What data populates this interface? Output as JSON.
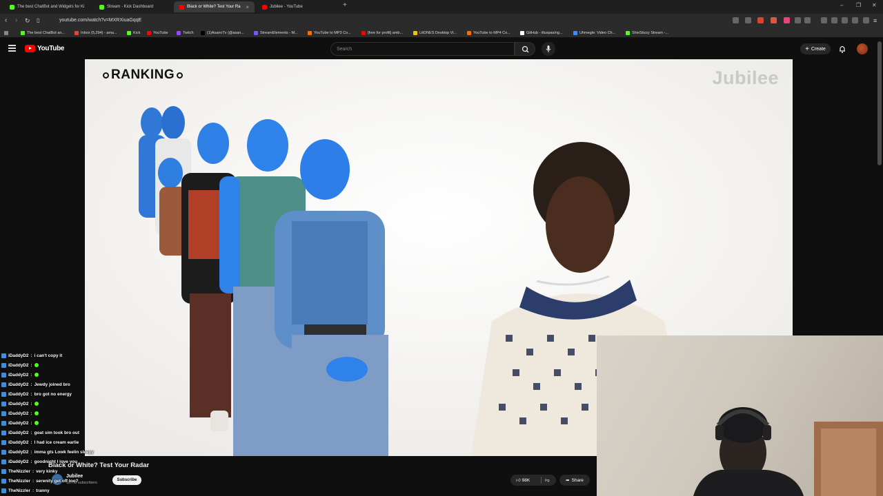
{
  "browser": {
    "tabs": [
      {
        "title": "The best ChatBot and Widgets for Ki",
        "color": "#53fc18"
      },
      {
        "title": "Stream - Kick Dashboard",
        "color": "#53fc18"
      },
      {
        "title": "Black or White? Test Your Ra",
        "color": "#ff0000",
        "active": true
      },
      {
        "title": "Jubilee - YouTube",
        "color": "#ff0000"
      }
    ],
    "url": "youtube.com/watch?v=MXRXiuaGqqE",
    "bookmarks": [
      {
        "label": "The best ChatBot an...",
        "color": "#53fc18"
      },
      {
        "label": "Inbox (5,294) - ama...",
        "color": "#ea4335"
      },
      {
        "label": "Kick",
        "color": "#53fc18"
      },
      {
        "label": "YouTube",
        "color": "#ff0000"
      },
      {
        "label": "Twitch",
        "color": "#9146ff"
      },
      {
        "label": "(1)AsanoTv (@asan...",
        "color": "#000000"
      },
      {
        "label": "StreamElements - M...",
        "color": "#6b5bff"
      },
      {
        "label": "YouTube to MP3 Co...",
        "color": "#ff6b00"
      },
      {
        "label": "[free for profit] amb...",
        "color": "#ff0000"
      },
      {
        "label": "LitONES Desktop Vi...",
        "color": "#f5c400"
      },
      {
        "label": "YouTube to MP4 Co...",
        "color": "#ff6b00"
      },
      {
        "label": "GitHub - illuspas/ng...",
        "color": "#ffffff"
      },
      {
        "label": "Uhmegle: Video Ch...",
        "color": "#3a8bff"
      },
      {
        "label": "ShieStizzy Stream -...",
        "color": "#53fc18"
      }
    ]
  },
  "youtube": {
    "logo_text": "YouTube",
    "search_placeholder": "Search",
    "create_label": "Create"
  },
  "video": {
    "ranking_text": "RANKING",
    "jubilee_watermark": "Jubilee",
    "title": "Black or White? Test Your Radar",
    "channel": "Jubilee",
    "subscribers": "10.7M subscribers",
    "subscribe_label": "Subscribe",
    "likes": "98K",
    "share_label": "Share"
  },
  "chat": [
    {
      "user": "iDaddyD2",
      "text": "i can't copy it"
    },
    {
      "user": "iDaddyD2",
      "text": "",
      "emote": true
    },
    {
      "user": "iDaddyD2",
      "text": "",
      "emote": true
    },
    {
      "user": "iDaddyD2",
      "text": "Jewdy joined bro"
    },
    {
      "user": "iDaddyD2",
      "text": "bro got no energy"
    },
    {
      "user": "iDaddyD2",
      "text": "",
      "emote": true
    },
    {
      "user": "iDaddyD2",
      "text": "",
      "emote": true
    },
    {
      "user": "iDaddyD2",
      "text": "",
      "emote": true
    },
    {
      "user": "iDaddyD2",
      "text": "goat sim took bro out"
    },
    {
      "user": "iDaddyD2",
      "text": "I had ice cream earlie"
    },
    {
      "user": "iDaddyD2",
      "text": "imma gts Lowk feelin sleepy"
    },
    {
      "user": "iDaddyD2",
      "text": "goodnight I love you"
    },
    {
      "user": "TheNizzler",
      "text": "very kinky"
    },
    {
      "user": "TheNizzler",
      "text": "serenity get off too?"
    },
    {
      "user": "TheNizzler",
      "text": "tranny"
    }
  ]
}
